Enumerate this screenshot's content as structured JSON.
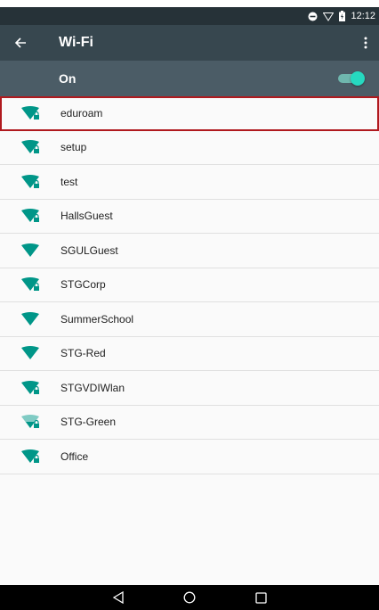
{
  "status_bar": {
    "time": "12:12",
    "icons": [
      "do-not-disturb-icon",
      "wifi-signal-icon",
      "battery-icon"
    ]
  },
  "app_bar": {
    "title": "Wi-Fi",
    "back_icon": "arrow-back-icon",
    "menu_icon": "more-vert-icon"
  },
  "master_switch": {
    "label": "On",
    "state": "on"
  },
  "networks": [
    {
      "ssid": "eduroam",
      "secured": true,
      "signal": "full",
      "highlighted": true
    },
    {
      "ssid": "setup",
      "secured": true,
      "signal": "full"
    },
    {
      "ssid": "test",
      "secured": true,
      "signal": "full"
    },
    {
      "ssid": "HallsGuest",
      "secured": true,
      "signal": "full"
    },
    {
      "ssid": "SGULGuest",
      "secured": false,
      "signal": "full"
    },
    {
      "ssid": "STGCorp",
      "secured": true,
      "signal": "full"
    },
    {
      "ssid": "SummerSchool",
      "secured": false,
      "signal": "full"
    },
    {
      "ssid": "STG-Red",
      "secured": false,
      "signal": "full"
    },
    {
      "ssid": "STGVDIWlan",
      "secured": true,
      "signal": "full"
    },
    {
      "ssid": "STG-Green",
      "secured": true,
      "signal": "weak"
    },
    {
      "ssid": "Office",
      "secured": true,
      "signal": "full"
    }
  ],
  "nav_bar": {
    "back": "nav-back-icon",
    "home": "nav-home-icon",
    "recents": "nav-recents-icon"
  },
  "colors": {
    "accent": "#009688",
    "toolbar": "#37474f",
    "subbar": "#4b5c66",
    "highlight": "#b0191e"
  }
}
